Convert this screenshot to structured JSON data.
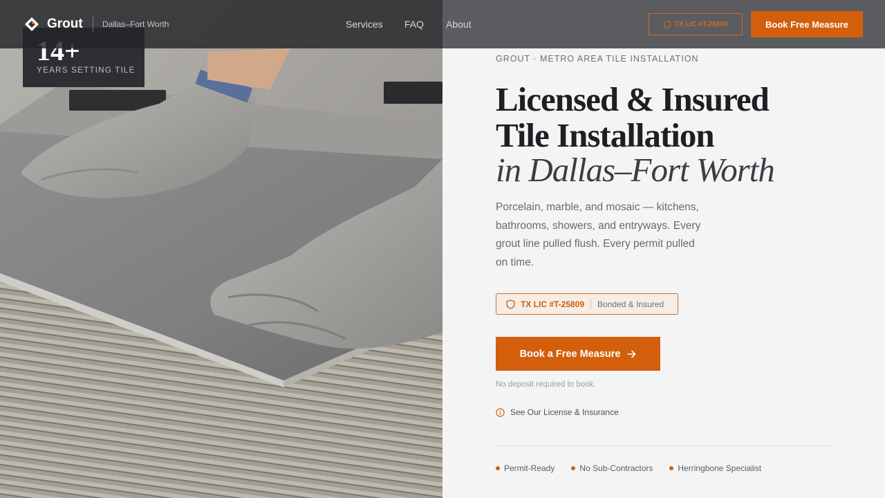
{
  "header": {
    "brand": "Grout",
    "region": "Dallas–Fort Worth",
    "nav": [
      "Services",
      "FAQ",
      "About"
    ],
    "license_button": "TX LIC #T-25809",
    "cta": "Book Free Measure"
  },
  "stat": {
    "number": "14+",
    "label": "YEARS SETTING TILE"
  },
  "hero": {
    "eyebrow": "GROUT · METRO AREA TILE INSTALLATION",
    "title_line1": "Licensed & Insured",
    "title_line2": "Tile Installation",
    "title_italic": "in Dallas–Fort Worth",
    "description": "Porcelain, marble, and mosaic — kitchens, bathrooms, showers, and entryways. Every grout line pulled flush. Every permit pulled on time.",
    "badge_license": "TX LIC #T-25809",
    "badge_insured": "Bonded & Insured",
    "cta": "Book a Free Measure",
    "note": "No deposit required to book.",
    "license_link": "See Our License & Insurance",
    "features": [
      "Permit-Ready",
      "No Sub-Contractors",
      "Herringbone Specialist"
    ]
  },
  "colors": {
    "accent": "#d35f0c",
    "heading": "#1d1f23",
    "header_bg": "#5b5c60"
  }
}
